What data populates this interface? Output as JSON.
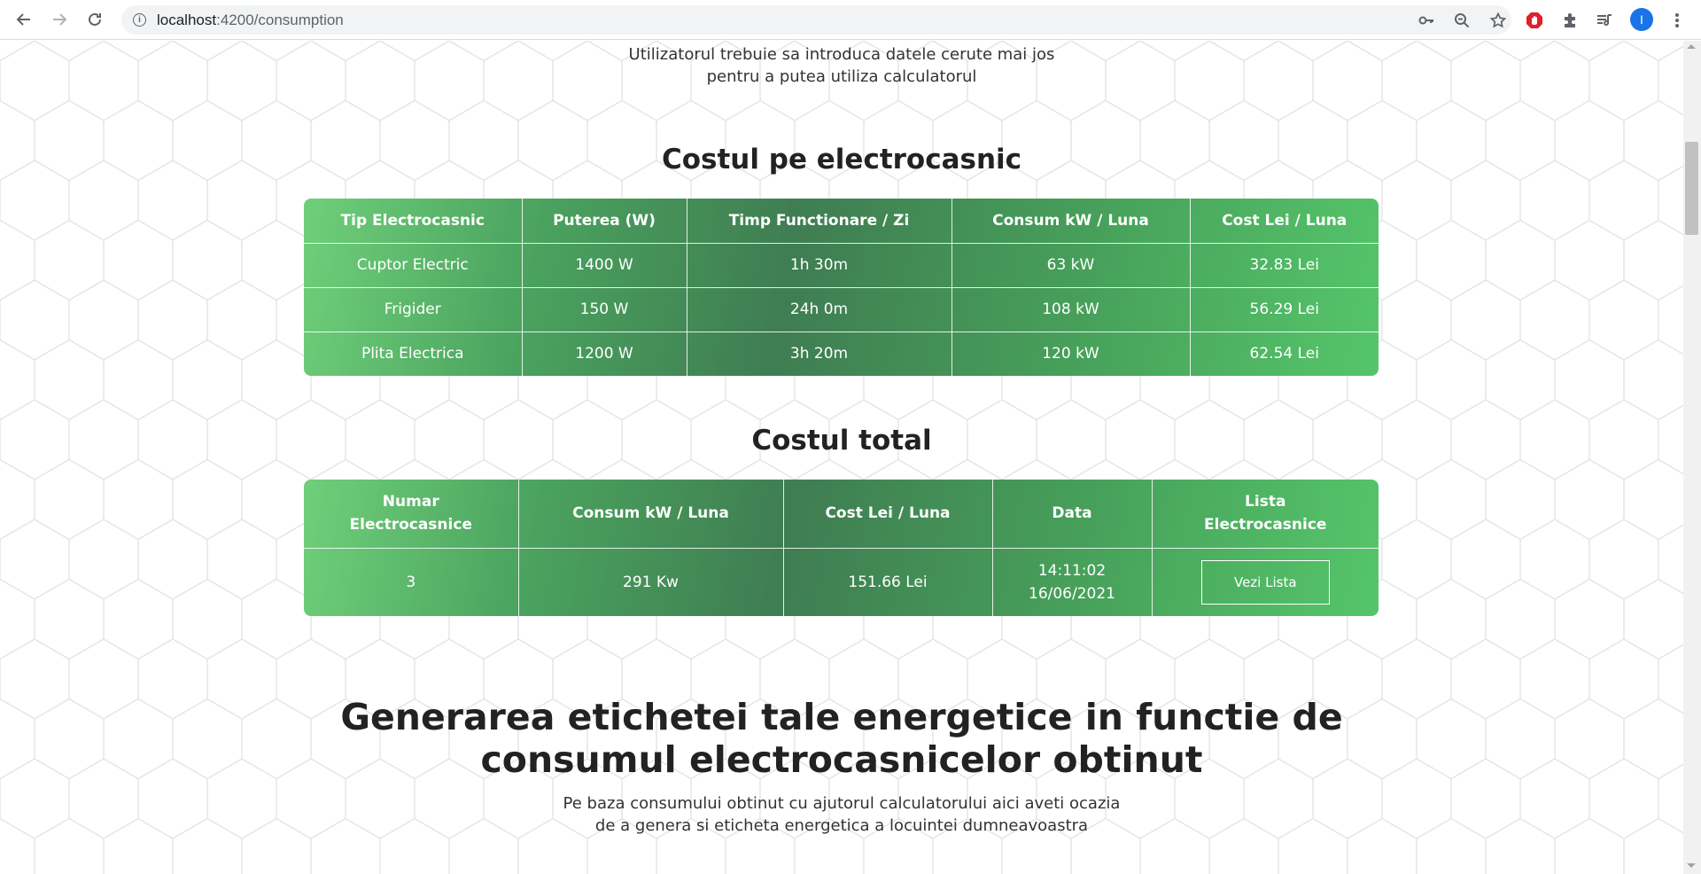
{
  "browser": {
    "url_host": "localhost",
    "url_path": ":4200/consumption",
    "avatar_letter": "I",
    "icons": [
      "back-arrow-icon",
      "forward-arrow-icon",
      "reload-icon",
      "site-info-icon",
      "key-icon",
      "zoom-out-icon",
      "star-icon",
      "adblock-icon",
      "extensions-icon",
      "reading-list-icon",
      "menu-dots-icon"
    ]
  },
  "intro": {
    "line1": "Utilizatorul trebuie sa introduca datele cerute mai jos",
    "line2": "pentru a putea utiliza calculatorul"
  },
  "appliance_section": {
    "title": "Costul pe electrocasnic",
    "headers": [
      "Tip Electrocasnic",
      "Puterea (W)",
      "Timp Functionare / Zi",
      "Consum kW / Luna",
      "Cost Lei / Luna"
    ],
    "rows": [
      [
        "Cuptor Electric",
        "1400 W",
        "1h 30m",
        "63 kW",
        "32.83 Lei"
      ],
      [
        "Frigider",
        "150 W",
        "24h 0m",
        "108 kW",
        "56.29 Lei"
      ],
      [
        "Plita Electrica",
        "1200 W",
        "3h 20m",
        "120 kW",
        "62.54 Lei"
      ]
    ]
  },
  "total_section": {
    "title": "Costul total",
    "headers": [
      {
        "l1": "Numar",
        "l2": "Electrocasnice"
      },
      {
        "l1": "Consum kW / Luna",
        "l2": ""
      },
      {
        "l1": "Cost Lei / Luna",
        "l2": ""
      },
      {
        "l1": "Data",
        "l2": ""
      },
      {
        "l1": "Lista",
        "l2": "Electrocasnice"
      }
    ],
    "row": {
      "count": "3",
      "consumption": "291 Kw",
      "cost": "151.66 Lei",
      "time": "14:11:02",
      "date": "16/06/2021",
      "button_label": "Vezi Lista"
    }
  },
  "label_section": {
    "title_line1": "Generarea etichetei tale energetice in functie de",
    "title_line2": "consumul electrocasnicelor obtinut",
    "sub_line1": "Pe baza consumului obtinut cu ajutorul calculatorului aici aveti ocazia",
    "sub_line2": "de a genera si eticheta energetica a locuintei dumneavoastra"
  },
  "colors": {
    "table_green_light": "#6fcf7a",
    "table_green_dark": "#3f7d52",
    "accent_blue": "#1a73e8"
  }
}
